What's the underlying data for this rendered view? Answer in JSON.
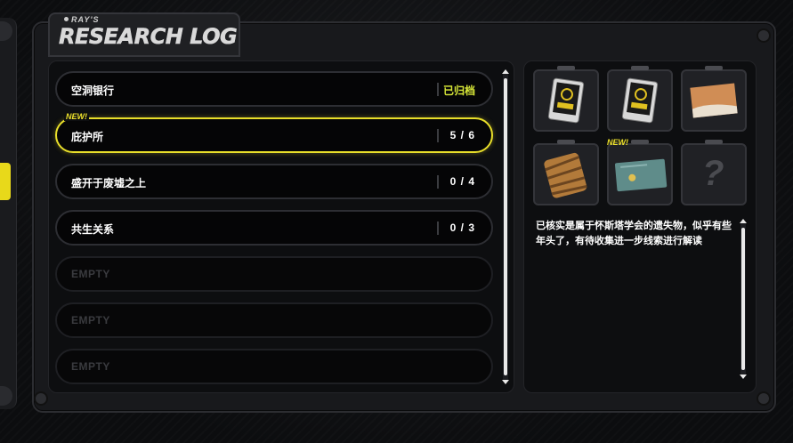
{
  "header": {
    "brand": "RAY'S",
    "title": "RESEARCH LOG"
  },
  "log_list": {
    "new_label": "NEW!",
    "entries": [
      {
        "name": "空洞银行",
        "progress": "已归档",
        "state": "archived"
      },
      {
        "name": "庇护所",
        "progress": "5 / 6",
        "state": "selected",
        "is_new": true
      },
      {
        "name": "盛开于废墟之上",
        "progress": "0 / 4",
        "state": "normal"
      },
      {
        "name": "共生关系",
        "progress": "0 / 3",
        "state": "normal"
      },
      {
        "name": "EMPTY",
        "progress": "",
        "state": "empty"
      },
      {
        "name": "EMPTY",
        "progress": "",
        "state": "empty"
      },
      {
        "name": "EMPTY",
        "progress": "",
        "state": "empty"
      }
    ]
  },
  "items": {
    "new_label": "NEW!",
    "slots": [
      {
        "icon": "tape-cartridge-icon"
      },
      {
        "icon": "tape-cartridge-icon"
      },
      {
        "icon": "paper-document-icon"
      },
      {
        "icon": "wrapped-bundle-icon"
      },
      {
        "icon": "teal-card-icon",
        "is_new": true
      },
      {
        "icon": "unknown-question-icon",
        "label": "?"
      }
    ]
  },
  "description": "已核实是属于怀斯塔学会的遗失物，似乎有些年头了，有待收集进一步线索进行解读",
  "colors": {
    "accent": "#e8de2a",
    "archived": "#d8e838",
    "row_border": "#2d2e33",
    "empty_text": "#3a3b3f"
  }
}
